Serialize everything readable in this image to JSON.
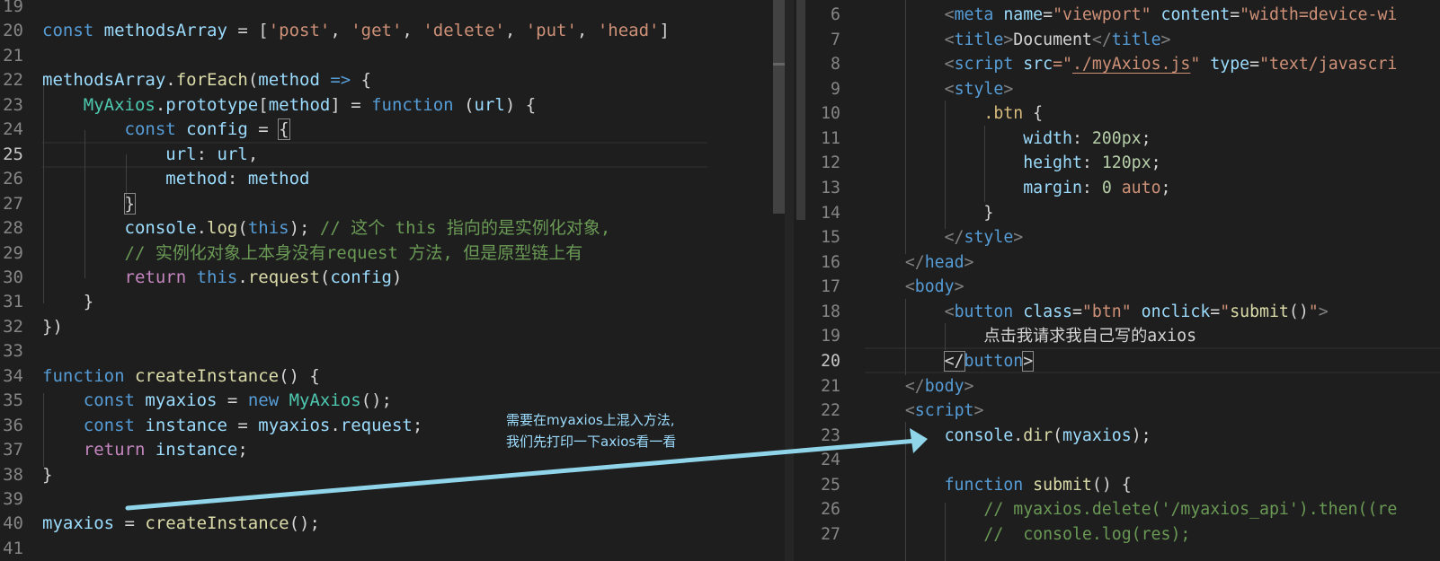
{
  "left_editor": {
    "active_line": 25,
    "lines": [
      {
        "n": 19,
        "t": []
      },
      {
        "n": 20,
        "t": [
          [
            "const ",
            "kw"
          ],
          [
            "methodsArray",
            "var"
          ],
          [
            " = [",
            "pl"
          ],
          [
            "'post'",
            "str"
          ],
          [
            ", ",
            "pl"
          ],
          [
            "'get'",
            "str"
          ],
          [
            ", ",
            "pl"
          ],
          [
            "'delete'",
            "str"
          ],
          [
            ", ",
            "pl"
          ],
          [
            "'put'",
            "str"
          ],
          [
            ", ",
            "pl"
          ],
          [
            "'head'",
            "str"
          ],
          [
            "]",
            "pl"
          ]
        ]
      },
      {
        "n": 21,
        "t": []
      },
      {
        "n": 22,
        "t": [
          [
            "methodsArray",
            "var"
          ],
          [
            ".",
            "pl"
          ],
          [
            "forEach",
            "fn"
          ],
          [
            "(",
            "pl"
          ],
          [
            "method",
            "var"
          ],
          [
            " => ",
            "kw"
          ],
          [
            "{",
            "pl"
          ]
        ]
      },
      {
        "n": 23,
        "t": [
          [
            "    ",
            "pl"
          ],
          [
            "MyAxios",
            "cls"
          ],
          [
            ".",
            "pl"
          ],
          [
            "prototype",
            "var"
          ],
          [
            "[",
            "pl"
          ],
          [
            "method",
            "var"
          ],
          [
            "] = ",
            "pl"
          ],
          [
            "function",
            "kw"
          ],
          [
            " (",
            "pl"
          ],
          [
            "url",
            "var"
          ],
          [
            ") {",
            "pl"
          ]
        ]
      },
      {
        "n": 24,
        "t": [
          [
            "        ",
            "pl"
          ],
          [
            "const ",
            "kw"
          ],
          [
            "config",
            "var"
          ],
          [
            " = ",
            "pl"
          ],
          [
            "{",
            "bracket"
          ]
        ]
      },
      {
        "n": 25,
        "t": [
          [
            "            ",
            "pl"
          ],
          [
            "url",
            "var"
          ],
          [
            ": ",
            "pl"
          ],
          [
            "url",
            "var"
          ],
          [
            ",",
            "pl"
          ]
        ]
      },
      {
        "n": 26,
        "t": [
          [
            "            ",
            "pl"
          ],
          [
            "method",
            "var"
          ],
          [
            ": ",
            "pl"
          ],
          [
            "method",
            "var"
          ]
        ]
      },
      {
        "n": 27,
        "t": [
          [
            "        ",
            "pl"
          ],
          [
            "}",
            "bracket"
          ]
        ]
      },
      {
        "n": 28,
        "t": [
          [
            "        ",
            "pl"
          ],
          [
            "console",
            "var"
          ],
          [
            ".",
            "pl"
          ],
          [
            "log",
            "fn"
          ],
          [
            "(",
            "pl"
          ],
          [
            "this",
            "kw"
          ],
          [
            "); ",
            "pl"
          ],
          [
            "// 这个 this 指向的是实例化对象,",
            "cm"
          ]
        ]
      },
      {
        "n": 29,
        "t": [
          [
            "        ",
            "pl"
          ],
          [
            "// 实例化对象上本身没有request 方法, 但是原型链上有",
            "cm"
          ]
        ]
      },
      {
        "n": 30,
        "t": [
          [
            "        ",
            "pl"
          ],
          [
            "return ",
            "ctl"
          ],
          [
            "this",
            "kw"
          ],
          [
            ".",
            "pl"
          ],
          [
            "request",
            "fn"
          ],
          [
            "(",
            "pl"
          ],
          [
            "config",
            "var"
          ],
          [
            ")",
            "pl"
          ]
        ]
      },
      {
        "n": 31,
        "t": [
          [
            "    }",
            "pl"
          ]
        ]
      },
      {
        "n": 32,
        "t": [
          [
            "})",
            "pl"
          ]
        ]
      },
      {
        "n": 33,
        "t": []
      },
      {
        "n": 34,
        "t": [
          [
            "function ",
            "kw"
          ],
          [
            "createInstance",
            "fn"
          ],
          [
            "() {",
            "pl"
          ]
        ]
      },
      {
        "n": 35,
        "t": [
          [
            "    ",
            "pl"
          ],
          [
            "const ",
            "kw"
          ],
          [
            "myaxios",
            "var"
          ],
          [
            " = ",
            "pl"
          ],
          [
            "new ",
            "kw"
          ],
          [
            "MyAxios",
            "cls"
          ],
          [
            "();",
            "pl"
          ]
        ]
      },
      {
        "n": 36,
        "t": [
          [
            "    ",
            "pl"
          ],
          [
            "const ",
            "kw"
          ],
          [
            "instance",
            "var"
          ],
          [
            " = ",
            "pl"
          ],
          [
            "myaxios",
            "var"
          ],
          [
            ".",
            "pl"
          ],
          [
            "request",
            "var"
          ],
          [
            ";",
            "pl"
          ]
        ]
      },
      {
        "n": 37,
        "t": [
          [
            "    ",
            "pl"
          ],
          [
            "return ",
            "ctl"
          ],
          [
            "instance",
            "var"
          ],
          [
            ";",
            "pl"
          ]
        ]
      },
      {
        "n": 38,
        "t": [
          [
            "}",
            "pl"
          ]
        ]
      },
      {
        "n": 39,
        "t": []
      },
      {
        "n": 40,
        "t": [
          [
            "myaxios",
            "var"
          ],
          [
            " = ",
            "pl"
          ],
          [
            "createInstance",
            "fn"
          ],
          [
            "();",
            "pl"
          ]
        ]
      },
      {
        "n": 41,
        "t": []
      }
    ]
  },
  "right_editor": {
    "active_line": 20,
    "lines": [
      {
        "n": 6,
        "t": [
          [
            "        ",
            "pl"
          ],
          [
            "<",
            "br"
          ],
          [
            "meta ",
            "tag"
          ],
          [
            "name",
            "attr"
          ],
          [
            "=",
            "pl"
          ],
          [
            "\"viewport\"",
            "str"
          ],
          [
            " ",
            "pl"
          ],
          [
            "content",
            "attr"
          ],
          [
            "=",
            "pl"
          ],
          [
            "\"width=device-wi",
            "str"
          ]
        ]
      },
      {
        "n": 7,
        "t": [
          [
            "        ",
            "pl"
          ],
          [
            "<",
            "br"
          ],
          [
            "title",
            "tag"
          ],
          [
            ">",
            "br"
          ],
          [
            "Document",
            "txt"
          ],
          [
            "</",
            "br"
          ],
          [
            "title",
            "tag"
          ],
          [
            ">",
            "br"
          ]
        ]
      },
      {
        "n": 8,
        "t": [
          [
            "        ",
            "pl"
          ],
          [
            "<",
            "br"
          ],
          [
            "script ",
            "tag"
          ],
          [
            "src",
            "attr"
          ],
          [
            "=\"",
            "str"
          ],
          [
            "./myAxios.js",
            "link"
          ],
          [
            "\" ",
            "str"
          ],
          [
            "type",
            "attr"
          ],
          [
            "=",
            "pl"
          ],
          [
            "\"text/javascri",
            "str"
          ]
        ]
      },
      {
        "n": 9,
        "t": [
          [
            "        ",
            "pl"
          ],
          [
            "<",
            "br"
          ],
          [
            "style",
            "tag"
          ],
          [
            ">",
            "br"
          ]
        ]
      },
      {
        "n": 10,
        "t": [
          [
            "            ",
            "pl"
          ],
          [
            ".btn",
            "sel"
          ],
          [
            " {",
            "pl"
          ]
        ]
      },
      {
        "n": 11,
        "t": [
          [
            "                ",
            "pl"
          ],
          [
            "width",
            "attr"
          ],
          [
            ": ",
            "pl"
          ],
          [
            "200px",
            "num"
          ],
          [
            ";",
            "pl"
          ]
        ]
      },
      {
        "n": 12,
        "t": [
          [
            "                ",
            "pl"
          ],
          [
            "height",
            "attr"
          ],
          [
            ": ",
            "pl"
          ],
          [
            "120px",
            "num"
          ],
          [
            ";",
            "pl"
          ]
        ]
      },
      {
        "n": 13,
        "t": [
          [
            "                ",
            "pl"
          ],
          [
            "margin",
            "attr"
          ],
          [
            ": ",
            "pl"
          ],
          [
            "0",
            "num"
          ],
          [
            " ",
            "pl"
          ],
          [
            "auto",
            "str"
          ],
          [
            ";",
            "pl"
          ]
        ]
      },
      {
        "n": 14,
        "t": [
          [
            "            }",
            "pl"
          ]
        ]
      },
      {
        "n": 15,
        "t": [
          [
            "        ",
            "pl"
          ],
          [
            "</",
            "br"
          ],
          [
            "style",
            "tag"
          ],
          [
            ">",
            "br"
          ]
        ]
      },
      {
        "n": 16,
        "t": [
          [
            "    ",
            "pl"
          ],
          [
            "</",
            "br"
          ],
          [
            "head",
            "tag"
          ],
          [
            ">",
            "br"
          ]
        ]
      },
      {
        "n": 17,
        "t": [
          [
            "    ",
            "pl"
          ],
          [
            "<",
            "br"
          ],
          [
            "body",
            "tag"
          ],
          [
            ">",
            "br"
          ]
        ]
      },
      {
        "n": 18,
        "t": [
          [
            "        ",
            "pl"
          ],
          [
            "<",
            "br"
          ],
          [
            "button ",
            "tag"
          ],
          [
            "class",
            "attr"
          ],
          [
            "=",
            "pl"
          ],
          [
            "\"btn\"",
            "str"
          ],
          [
            " ",
            "pl"
          ],
          [
            "onclick",
            "attr"
          ],
          [
            "=",
            "pl"
          ],
          [
            "\"",
            "str"
          ],
          [
            "submit",
            "fn"
          ],
          [
            "()",
            "pl"
          ],
          [
            "\"",
            "str"
          ],
          [
            ">",
            "br"
          ]
        ]
      },
      {
        "n": 19,
        "t": [
          [
            "            ",
            "pl"
          ],
          [
            "点击我请求我自己写的axios",
            "txt"
          ]
        ]
      },
      {
        "n": 20,
        "t": [
          [
            "        ",
            "pl"
          ],
          [
            "</",
            "bracket"
          ],
          [
            "button",
            "tag"
          ],
          [
            ">",
            "bracket"
          ]
        ]
      },
      {
        "n": 21,
        "t": [
          [
            "    ",
            "pl"
          ],
          [
            "</",
            "br"
          ],
          [
            "body",
            "tag"
          ],
          [
            ">",
            "br"
          ]
        ]
      },
      {
        "n": 22,
        "t": [
          [
            "    ",
            "pl"
          ],
          [
            "<",
            "br"
          ],
          [
            "script",
            "tag"
          ],
          [
            ">",
            "br"
          ]
        ]
      },
      {
        "n": 23,
        "t": [
          [
            "        ",
            "pl"
          ],
          [
            "console",
            "var"
          ],
          [
            ".",
            "pl"
          ],
          [
            "dir",
            "fn"
          ],
          [
            "(",
            "pl"
          ],
          [
            "myaxios",
            "var"
          ],
          [
            ");",
            "pl"
          ]
        ]
      },
      {
        "n": 24,
        "t": []
      },
      {
        "n": 25,
        "t": [
          [
            "        ",
            "pl"
          ],
          [
            "function ",
            "kw"
          ],
          [
            "submit",
            "fn"
          ],
          [
            "() {",
            "pl"
          ]
        ]
      },
      {
        "n": 26,
        "t": [
          [
            "            ",
            "pl"
          ],
          [
            "// myaxios.delete('/myaxios_api').then((re",
            "cm"
          ]
        ]
      },
      {
        "n": 27,
        "t": [
          [
            "            ",
            "pl"
          ],
          [
            "//  console.log(res);",
            "cm"
          ]
        ]
      }
    ]
  },
  "annotation": {
    "line1": "需要在myaxios上混入方法,",
    "line2": "我们先打印一下axios看一看",
    "arrow_color": "#8fd4e8"
  }
}
